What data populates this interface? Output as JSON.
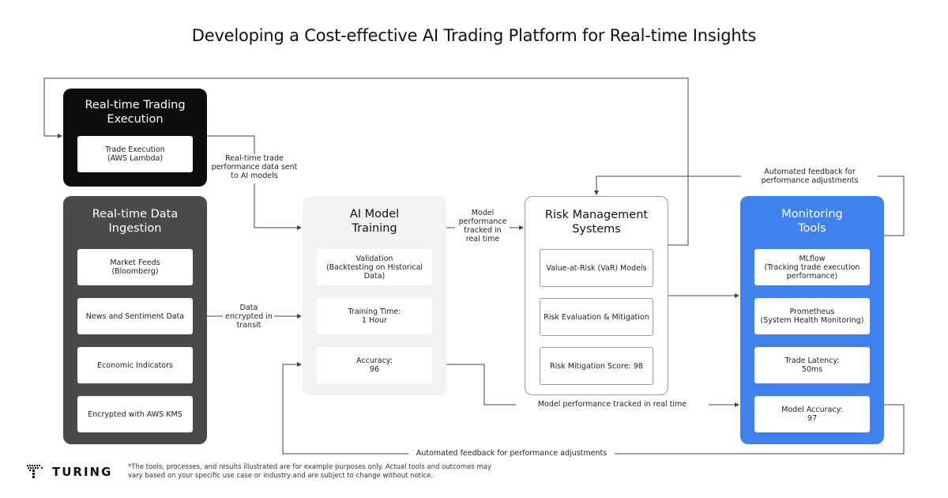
{
  "title": "Developing a Cost-effective AI Trading Platform for Real-time Insights",
  "colors": {
    "execution_panel": "#0d0d0d",
    "ingestion_panel": "#4a4a4a",
    "training_panel": "#f2f2f2",
    "risk_panel": "#ffffff",
    "monitoring_panel": "#3f82ef",
    "connector": "#444444"
  },
  "panels": {
    "execution": {
      "title": "Real-time Trading Execution",
      "cards": [
        "Trade Execution\n(AWS Lambda)"
      ]
    },
    "ingestion": {
      "title": "Real-time Data Ingestion",
      "cards": [
        "Market Feeds\n(Bloomberg)",
        "News and Sentiment Data",
        "Economic Indicators",
        "Encrypted with AWS KMS"
      ]
    },
    "training": {
      "title": "AI Model Training",
      "cards": [
        "Validation\n(Backtesting on Historical Data)",
        "Training Time:\n1 Hour",
        "Accuracy:\n96"
      ]
    },
    "risk": {
      "title": "Risk Management Systems",
      "cards": [
        "Value-at-Risk (VaR) Models",
        "Risk Evaluation & Mitigation",
        "Risk Mitigation Score: 98"
      ]
    },
    "monitoring": {
      "title": "Monitoring Tools",
      "cards": [
        "MLflow\n(Tracking trade execution performance)",
        "Prometheus\n(System Health Monitoring)",
        "Trade Latency:\n50ms",
        "Model Accuracy:\n97"
      ]
    }
  },
  "edge_labels": {
    "exec_to_training": "Real-time trade performance data sent to AI models",
    "ingestion_to_training": "Data encrypted in transit",
    "training_to_risk": "Model performance tracked in real time",
    "accuracy_to_monitoring": "Model performance tracked in real time",
    "monitoring_to_risk": "Automated feedback for performance adjustments",
    "monitoring_to_training": "Automated feedback for performance adjustments"
  },
  "footer": {
    "brand": "TURING",
    "disclaimer": "*The tools, processes, and results illustrated are for example purposes only. Actual tools and outcomes may vary based on your specific use case or industry and are subject to change without notice."
  }
}
